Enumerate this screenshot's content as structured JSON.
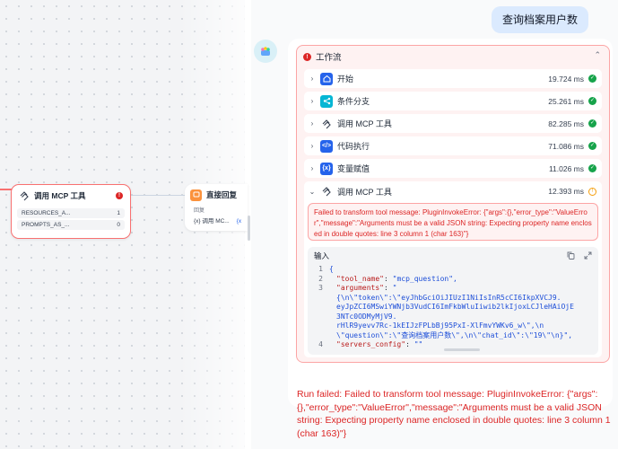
{
  "canvas": {
    "mcp_node": {
      "title": "调用 MCP 工具",
      "error_badge": "!",
      "rows": [
        {
          "name": "RESOURCES_A...",
          "value": "1"
        },
        {
          "name": "PROMPTS_AS_...",
          "value": "0"
        }
      ]
    },
    "reply_node": {
      "title": "直接回复",
      "sub_label": "回复",
      "var_text": "{x} 调用 MC...",
      "var_extra": "{x"
    }
  },
  "chat": {
    "user_message": "查询档案用户数",
    "workflow": {
      "title": "工作流",
      "steps": [
        {
          "label": "开始",
          "time": "19.724 ms",
          "status": "success",
          "icon": "home-icon",
          "color": "#2563eb"
        },
        {
          "label": "条件分支",
          "time": "25.261 ms",
          "status": "success",
          "icon": "branch-icon",
          "color": "#06b6d4"
        },
        {
          "label": "调用 MCP 工具",
          "time": "82.285 ms",
          "status": "success",
          "icon": "mcp-icon",
          "color": "#374151"
        },
        {
          "label": "代码执行",
          "time": "71.086 ms",
          "status": "success",
          "icon": "code-icon",
          "color": "#2563eb"
        },
        {
          "label": "变量赋值",
          "time": "11.026 ms",
          "status": "success",
          "icon": "variable-icon",
          "color": "#2563eb"
        }
      ],
      "open_step": {
        "label": "调用 MCP 工具",
        "time": "12.393 ms",
        "status": "warning",
        "error_text": "Failed to transform tool message: PluginInvokeError: {\"args\":{},\"error_type\":\"ValueError\",\"message\":\"Arguments must be a valid JSON string: Expecting property name enclosed in double quotes: line 3 column 1 (char 163)\"}",
        "input_label": "输入",
        "code_lines": [
          {
            "num": "1",
            "text": "{"
          },
          {
            "num": "2",
            "key": "\"tool_name\"",
            "val": "\"mcp_question\","
          },
          {
            "num": "3",
            "key": "\"arguments\"",
            "val": "\""
          },
          {
            "num": "",
            "val": "{\\n\\\"token\\\":\\\"eyJhbGciOiJIUzI1NiIsInR5cCI6IkpXVCJ9."
          },
          {
            "num": "",
            "val": "eyJpZCI6MSwiYWNjb3VudCI6ImFkbWluIiwib2lkIjoxLCJleHAiOjE"
          },
          {
            "num": "",
            "val": "3NTc0ODMyMjV9."
          },
          {
            "num": "",
            "val": "rHlR9yevv7Rc-1kEIJzFPLbBj95PxI-XlFmvYWKv6_w\\\",\\n"
          },
          {
            "num": "",
            "val": "\\\"question\\\":\\\"查询档案用户数\\\",\\n\\\"chat_id\\\":\\\"19\\\"\\n}\","
          },
          {
            "num": "4",
            "key": "\"servers_config\"",
            "val": "\"\""
          }
        ]
      }
    },
    "run_failed": "Run failed: Failed to transform tool message: PluginInvokeError: {\"args\":{},\"error_type\":\"ValueError\",\"message\":\"Arguments must be a valid JSON string: Expecting property name enclosed in double quotes: line 3 column 1 (char 163)\"}"
  }
}
